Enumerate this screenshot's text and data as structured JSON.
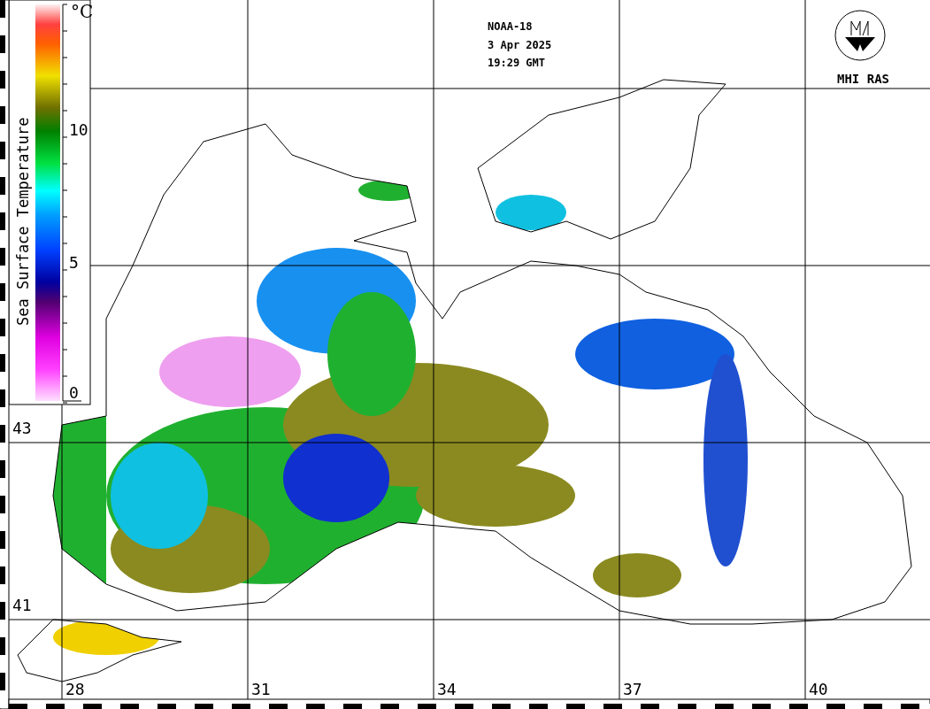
{
  "header": {
    "satellite": "NOAA-18",
    "date": "3 Apr 2025",
    "time": "19:29 GMT"
  },
  "logo": {
    "text": "MHI RAS"
  },
  "colorbar": {
    "title": "Sea Surface Temperature",
    "unit": "°C",
    "ticks": [
      "10",
      "5",
      "0"
    ]
  },
  "latitude_labels": [
    "43",
    "41"
  ],
  "longitude_labels": [
    "28",
    "31",
    "34",
    "37",
    "40"
  ]
}
